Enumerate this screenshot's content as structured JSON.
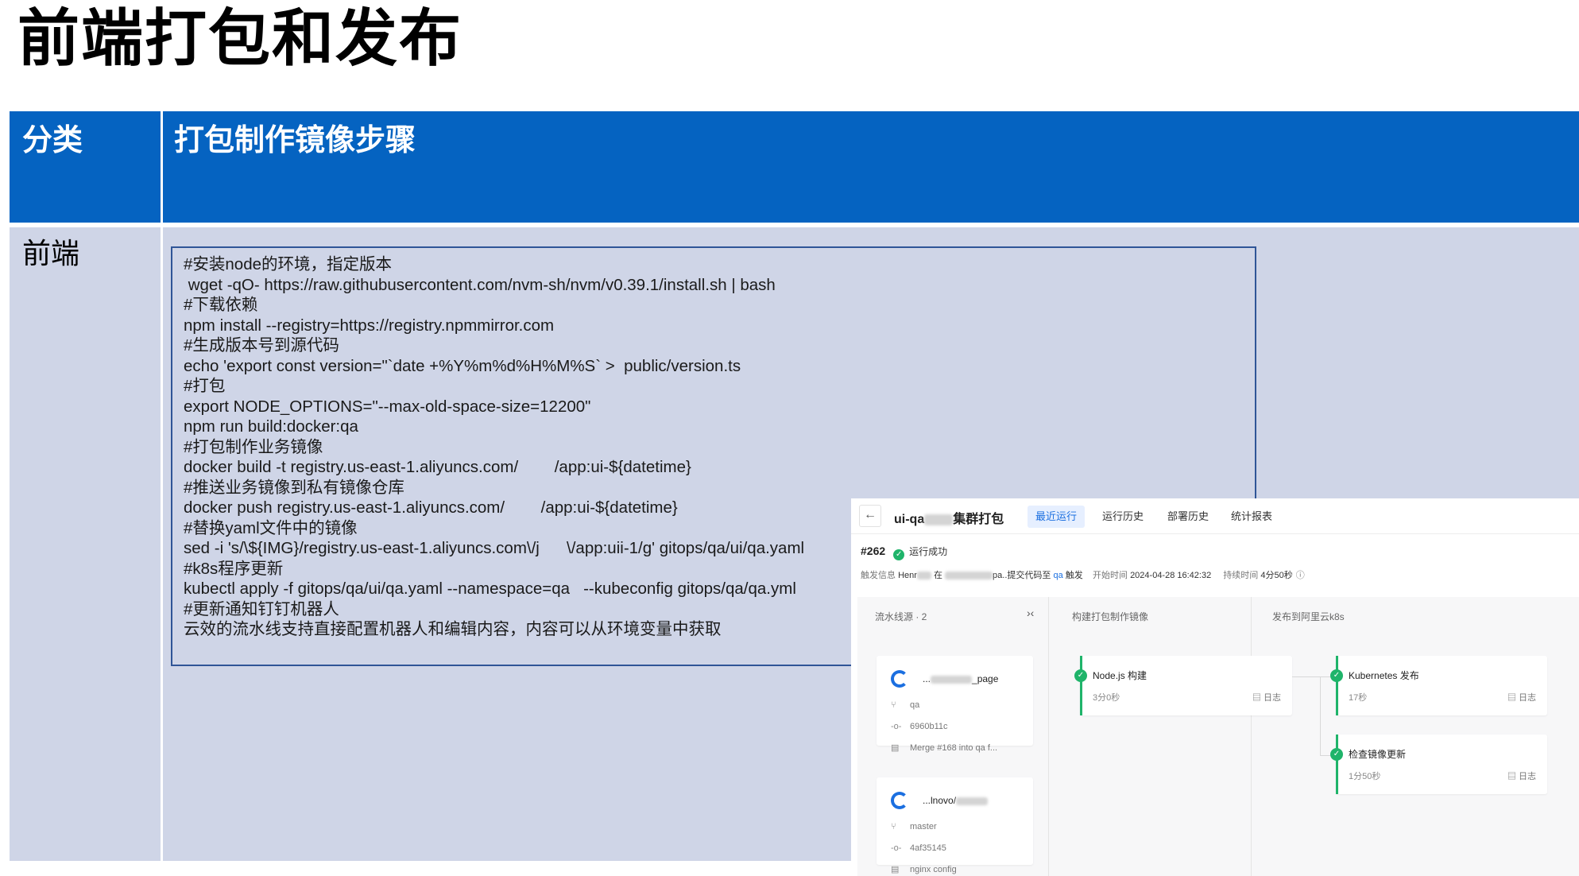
{
  "slide": {
    "title": "前端打包和发布"
  },
  "table": {
    "header_category": "分类",
    "header_steps": "打包制作镜像步骤",
    "row_category": "前端"
  },
  "code_lines": [
    "#安装node的环境，指定版本",
    " wget -qO- https://raw.githubusercontent.com/nvm-sh/nvm/v0.39.1/install.sh | bash",
    "#下载依赖",
    "npm install --registry=https://registry.npmmirror.com",
    "#生成版本号到源代码",
    "echo 'export const version=\"`date +%Y%m%d%H%M%S` >  public/version.ts",
    "#打包",
    "export NODE_OPTIONS=\"--max-old-space-size=12200\"",
    "npm run build:docker:qa",
    "#打包制作业务镜像",
    "docker build -t registry.us-east-1.aliyuncs.com/        /app:ui-${datetime}",
    "#推送业务镜像到私有镜像仓库",
    "docker push registry.us-east-1.aliyuncs.com/        /app:ui-${datetime}",
    "#替换yaml文件中的镜像",
    "sed -i 's/\\${IMG}/registry.us-east-1.aliyuncs.com\\/j      \\/app:uii-1/g' gitops/qa/ui/qa.yaml",
    "#k8s程序更新",
    "kubectl apply -f gitops/qa/ui/qa.yaml --namespace=qa   --kubeconfig gitops/qa/qa.yml",
    "#更新通知钉钉机器人",
    "云效的流水线支持直接配置机器人和编辑内容，内容可以从环境变量中获取"
  ],
  "pipeline": {
    "back_icon": "arrow-left-icon",
    "title_prefix": "ui-qa",
    "title_suffix": "集群打包",
    "tabs": [
      "最近运行",
      "运行历史",
      "部署历史",
      "统计报表"
    ],
    "run_number": "#262",
    "run_status": "运行成功",
    "meta": {
      "trigger_label": "触发信息",
      "trigger_user": "Henr",
      "trigger_mid": "在",
      "trigger_tail": "pa..提交代码至",
      "branch": "qa",
      "trigger_suffix": "触发",
      "start_label": "开始时间",
      "start_time": "2024-04-28 16:42:32",
      "duration_label": "持续时间",
      "duration": "4分50秒"
    },
    "sources_header": "流水线源 · 2",
    "sources": [
      {
        "name_prefix": "...",
        "name_suffix": "_page",
        "branch": "qa",
        "commit": "6960b11c",
        "message": "Merge #168 into qa f..."
      },
      {
        "name_prefix": "...lnovo/",
        "name_suffix": "",
        "branch": "master",
        "commit": "4af35145",
        "message": "nginx config"
      }
    ],
    "stage_build": {
      "header": "构建打包制作镜像",
      "jobs": [
        {
          "name": "Node.js 构建",
          "time": "3分0秒",
          "log": "日志"
        }
      ]
    },
    "stage_deploy": {
      "header": "发布到阿里云k8s",
      "jobs": [
        {
          "name": "Kubernetes 发布",
          "time": "17秒",
          "log": "日志"
        },
        {
          "name": "检查镜像更新",
          "time": "1分50秒",
          "log": "日志"
        }
      ]
    },
    "colors": {
      "accent": "#1b6fe0",
      "success": "#1fb46a",
      "header_blue": "#0563c1",
      "row_bg": "#cfd5e7"
    }
  }
}
